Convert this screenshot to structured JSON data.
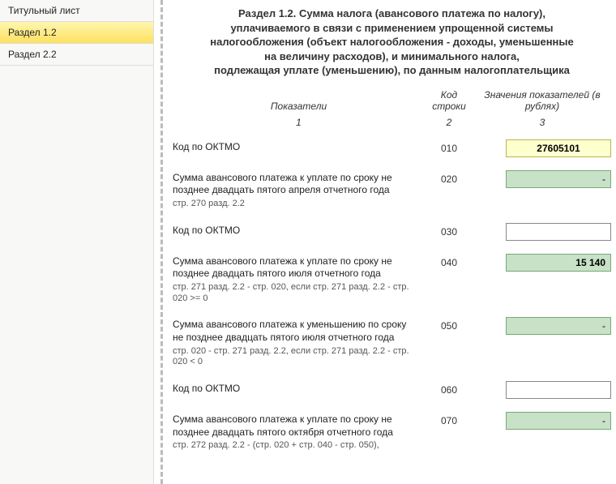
{
  "sidebar": {
    "items": [
      {
        "label": "Титульный лист"
      },
      {
        "label": "Раздел 1.2"
      },
      {
        "label": "Раздел 2.2"
      }
    ],
    "active_index": 1
  },
  "title": {
    "line1": "Раздел 1.2. Сумма налога (авансового платежа по налогу),",
    "line2": "уплачиваемого в связи с применением упрощенной системы",
    "line3": "налогообложения (объект налогообложения - доходы, уменьшенные",
    "line4": "на величину расходов), и минимального налога,",
    "line5": "подлежащая уплате (уменьшению), по данным налогоплательщика"
  },
  "headers": {
    "indicator": "Показатели",
    "code": "Код строки",
    "value": "Значения показателей (в рублях)",
    "col1": "1",
    "col2": "2",
    "col3": "3"
  },
  "rows": [
    {
      "label": "Код по ОКТМО",
      "sub": "",
      "code": "010",
      "value": "27605101",
      "style": "yellow"
    },
    {
      "label": "Сумма авансового платежа к уплате по сроку не позднее двадцать пятого апреля отчетного года",
      "sub": "стр. 270 разд. 2.2",
      "code": "020",
      "value": "-",
      "style": "green"
    },
    {
      "label": "Код по ОКТМО",
      "sub": "",
      "code": "030",
      "value": "",
      "style": "white"
    },
    {
      "label": "Сумма  авансового платежа к уплате по сроку не позднее двадцать пятого июля отчетного года",
      "sub": "стр. 271 разд. 2.2 - стр. 020,\nесли стр. 271 разд. 2.2 - стр. 020 >= 0",
      "code": "040",
      "value": "15 140",
      "style": "green filled"
    },
    {
      "label": "Сумма авансового платежа к уменьшению по сроку не позднее двадцать пятого июля отчетного года",
      "sub": "стр. 020 - стр. 271 разд. 2.2,\nесли стр. 271 разд. 2.2 - стр. 020 < 0",
      "code": "050",
      "value": "-",
      "style": "green"
    },
    {
      "label": "Код по ОКТМО",
      "sub": "",
      "code": "060",
      "value": "",
      "style": "white"
    },
    {
      "label": "Сумма авансового платежа к уплате по сроку не позднее двадцать пятого октября отчетного года",
      "sub": "стр. 272 разд. 2.2 - (стр. 020 + стр. 040 - стр. 050),",
      "code": "070",
      "value": "-",
      "style": "green"
    }
  ]
}
